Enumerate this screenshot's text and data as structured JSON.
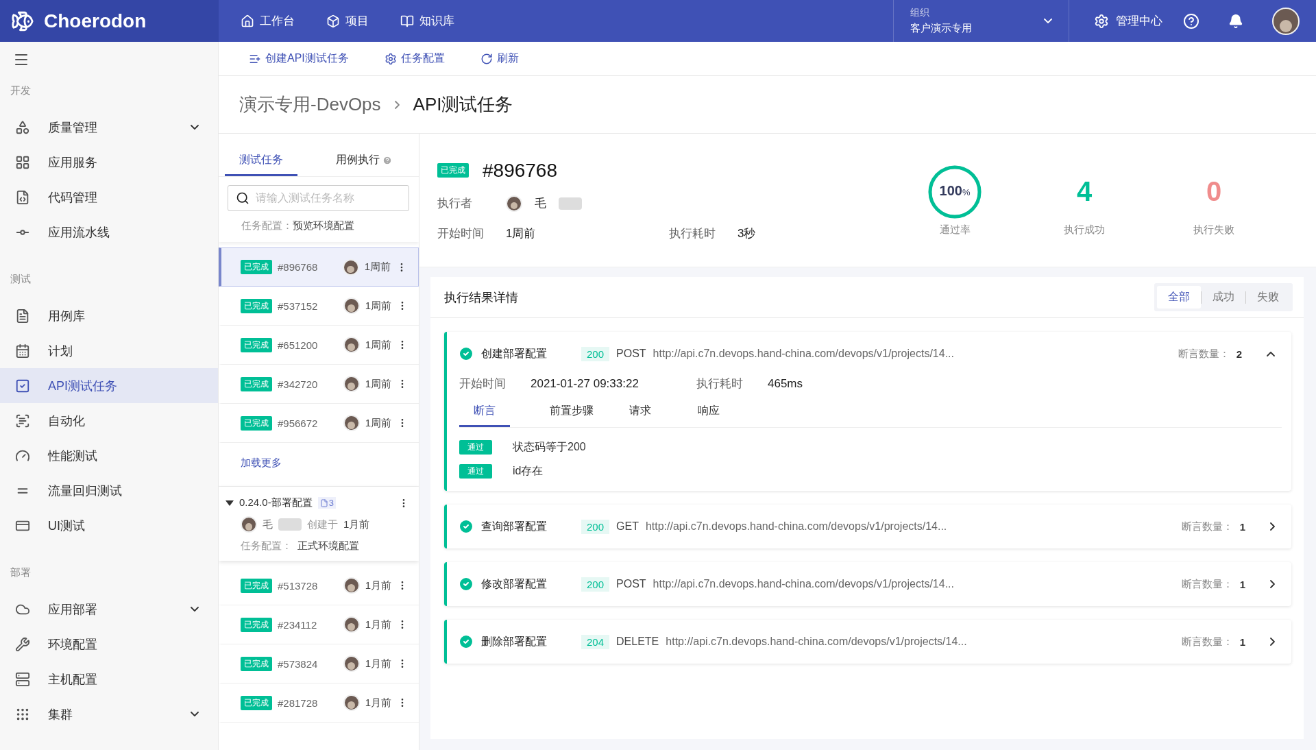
{
  "header": {
    "logo": "Choerodon",
    "nav": [
      {
        "label": "工作台"
      },
      {
        "label": "项目"
      },
      {
        "label": "知识库"
      }
    ],
    "org": {
      "label": "组织",
      "value": "客户演示专用"
    },
    "admin": "管理中心"
  },
  "toolbar": [
    {
      "label": "创建API测试任务"
    },
    {
      "label": "任务配置"
    },
    {
      "label": "刷新"
    }
  ],
  "sidebar": {
    "sections": [
      {
        "title": "开发",
        "items": [
          {
            "label": "质量管理",
            "expandable": true,
            "selected": false
          },
          {
            "label": "应用服务",
            "expandable": false,
            "selected": false
          },
          {
            "label": "代码管理",
            "expandable": false,
            "selected": false
          },
          {
            "label": "应用流水线",
            "expandable": false,
            "selected": false
          }
        ]
      },
      {
        "title": "测试",
        "items": [
          {
            "label": "用例库",
            "expandable": false,
            "selected": false
          },
          {
            "label": "计划",
            "expandable": false,
            "selected": false
          },
          {
            "label": "API测试任务",
            "expandable": false,
            "selected": true
          },
          {
            "label": "自动化",
            "expandable": false,
            "selected": false
          },
          {
            "label": "性能测试",
            "expandable": false,
            "selected": false
          },
          {
            "label": "流量回归测试",
            "expandable": false,
            "selected": false
          },
          {
            "label": "UI测试",
            "expandable": false,
            "selected": false
          }
        ]
      },
      {
        "title": "部署",
        "items": [
          {
            "label": "应用部署",
            "expandable": true,
            "selected": false
          },
          {
            "label": "环境配置",
            "expandable": false,
            "selected": false
          },
          {
            "label": "主机配置",
            "expandable": false,
            "selected": false
          },
          {
            "label": "集群",
            "expandable": true,
            "selected": false
          }
        ]
      }
    ]
  },
  "breadcrumb": [
    "演示专用-DevOps",
    "API测试任务"
  ],
  "task_panel": {
    "tabs": [
      {
        "label": "测试任务",
        "selected": true,
        "help": false
      },
      {
        "label": "用例执行",
        "selected": false,
        "help": true
      }
    ],
    "search": {
      "placeholder": "请输入测试任务名称"
    },
    "config": {
      "label": "任务配置：",
      "value": "预览环境配置"
    },
    "tasks": [
      {
        "status": "已完成",
        "id": "#896768",
        "time": "1周前",
        "selected": true
      },
      {
        "status": "已完成",
        "id": "#537152",
        "time": "1周前",
        "selected": false
      },
      {
        "status": "已完成",
        "id": "#651200",
        "time": "1周前",
        "selected": false
      },
      {
        "status": "已完成",
        "id": "#342720",
        "time": "1周前",
        "selected": false
      },
      {
        "status": "已完成",
        "id": "#956672",
        "time": "1周前",
        "selected": false
      }
    ],
    "load_more": "加载更多",
    "plan": {
      "title": "0.24.0-部署配置",
      "count": "3",
      "expanded": true,
      "creator": "毛",
      "created_label": "创建于",
      "created_time": "1月前",
      "config_label": "任务配置：",
      "config_value": "正式环境配置"
    },
    "plan_tasks": [
      {
        "status": "已完成",
        "id": "#513728",
        "time": "1月前",
        "selected": false
      },
      {
        "status": "已完成",
        "id": "#234112",
        "time": "1月前",
        "selected": false
      },
      {
        "status": "已完成",
        "id": "#573824",
        "time": "1月前",
        "selected": false
      },
      {
        "status": "已完成",
        "id": "#281728",
        "time": "1月前",
        "selected": false
      }
    ]
  },
  "detail": {
    "status": "已完成",
    "id": "#896768",
    "executor_label": "执行者",
    "executor": "毛",
    "start_label": "开始时间",
    "start": "1周前",
    "duration_label": "执行耗时",
    "duration": "3秒",
    "pass_rate": {
      "value": "100",
      "unit": "%",
      "label": "通过率",
      "level": 1
    },
    "success": {
      "value": "4",
      "label": "执行成功"
    },
    "fail": {
      "value": "0",
      "label": "执行失败"
    }
  },
  "results": {
    "title": "执行结果详情",
    "filters": [
      {
        "label": "全部",
        "selected": true
      },
      {
        "label": "成功",
        "selected": false
      },
      {
        "label": "失败",
        "selected": false
      }
    ],
    "items": [
      {
        "name": "创建部署配置",
        "code": "200",
        "method": "POST",
        "url": "http://api.c7n.devops.hand-china.com/devops/v1/projects/14...",
        "assert_label": "断言数量：",
        "assert_count": "2",
        "expanded": true,
        "start_label": "开始时间",
        "start": "2021-01-27 09:33:22",
        "duration_label": "执行耗时",
        "duration": "465ms",
        "tabs": [
          {
            "label": "断言",
            "selected": true
          },
          {
            "label": "前置步骤",
            "selected": false
          },
          {
            "label": "请求",
            "selected": false
          },
          {
            "label": "响应",
            "selected": false
          }
        ],
        "assertions": [
          {
            "status": "通过",
            "text": "状态码等于200"
          },
          {
            "status": "通过",
            "text": "id存在"
          }
        ]
      },
      {
        "name": "查询部署配置",
        "code": "200",
        "method": "GET",
        "url": "http://api.c7n.devops.hand-china.com/devops/v1/projects/14...",
        "assert_label": "断言数量：",
        "assert_count": "1",
        "expanded": false
      },
      {
        "name": "修改部署配置",
        "code": "200",
        "method": "POST",
        "url": "http://api.c7n.devops.hand-china.com/devops/v1/projects/14...",
        "assert_label": "断言数量：",
        "assert_count": "1",
        "expanded": false
      },
      {
        "name": "删除部署配置",
        "code": "204",
        "method": "DELETE",
        "url": "http://api.c7n.devops.hand-china.com/devops/v1/projects/14...",
        "assert_label": "断言数量：",
        "assert_count": "1",
        "expanded": false
      }
    ]
  }
}
